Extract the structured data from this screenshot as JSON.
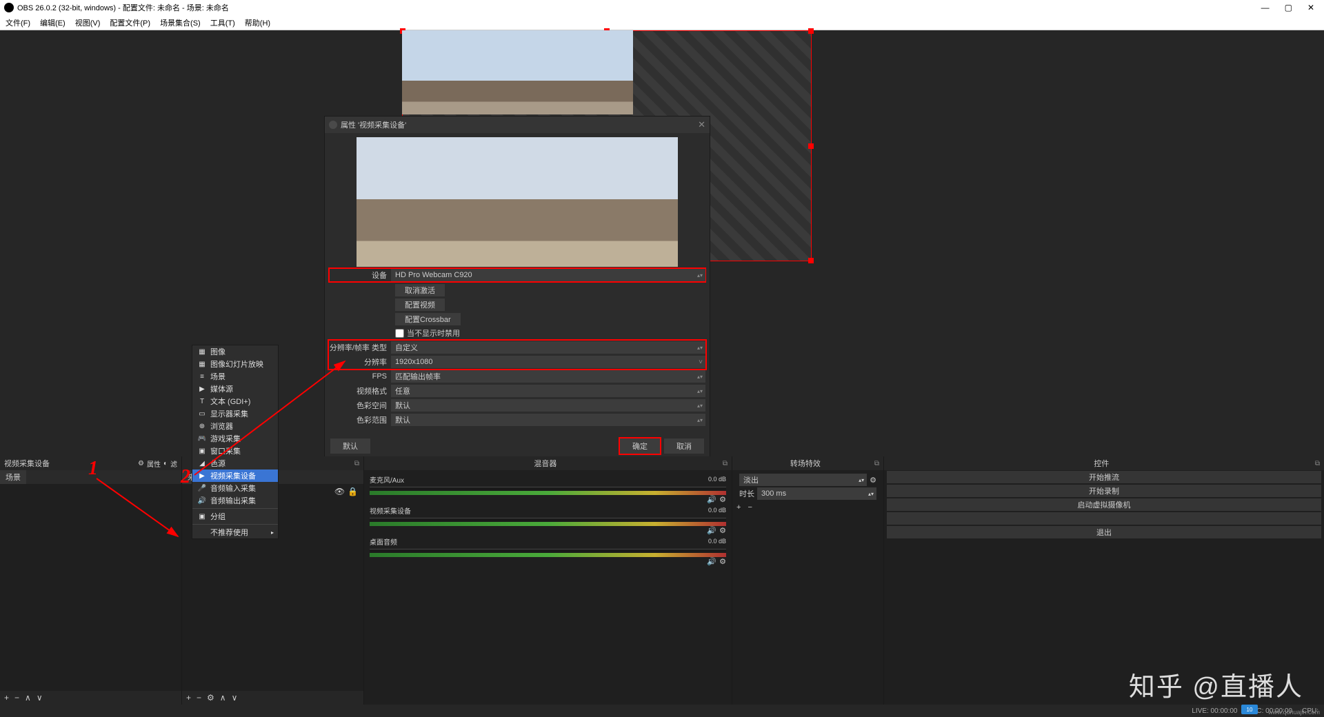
{
  "titlebar": {
    "text": "OBS 26.0.2 (32-bit, windows) - 配置文件: 未命名 - 场景: 未命名"
  },
  "menubar": {
    "items": [
      "文件(F)",
      "编辑(E)",
      "视图(V)",
      "配置文件(P)",
      "场景集合(S)",
      "工具(T)",
      "帮助(H)"
    ]
  },
  "dialog": {
    "title": "属性 '视频采集设备'",
    "device_lbl": "设备",
    "device_val": "HD Pro Webcam C920",
    "deactivate": "取消激活",
    "cfg_video": "配置视频",
    "cfg_crossbar": "配置Crossbar",
    "hide_lbl": "当不显示时禁用",
    "restype_lbl": "分辨率/帧率 类型",
    "restype_val": "自定义",
    "res_lbl": "分辨率",
    "res_val": "1920x1080",
    "fps_lbl": "FPS",
    "fps_val": "匹配输出帧率",
    "vfmt_lbl": "视频格式",
    "vfmt_val": "任意",
    "cspace_lbl": "色彩空间",
    "cspace_val": "默认",
    "crange_lbl": "色彩范围",
    "crange_val": "默认",
    "defaults": "默认",
    "ok": "确定",
    "cancel": "取消"
  },
  "ctx": {
    "items": [
      {
        "ico": "▦",
        "t": "图像"
      },
      {
        "ico": "▦",
        "t": "图像幻灯片放映"
      },
      {
        "ico": "≡",
        "t": "场景"
      },
      {
        "ico": "▶",
        "t": "媒体源"
      },
      {
        "ico": "T",
        "t": "文本 (GDI+)"
      },
      {
        "ico": "▭",
        "t": "显示器采集"
      },
      {
        "ico": "⊕",
        "t": "浏览器"
      },
      {
        "ico": "🎮",
        "t": "游戏采集"
      },
      {
        "ico": "▣",
        "t": "窗口采集"
      },
      {
        "ico": "◢",
        "t": "色源"
      },
      {
        "ico": "▶",
        "t": "视频采集设备",
        "sel": true
      },
      {
        "ico": "🎤",
        "t": "音频输入采集"
      },
      {
        "ico": "🔊",
        "t": "音频输出采集"
      }
    ],
    "group": "分组",
    "deprecated": "不推荐使用"
  },
  "docks": {
    "src_hdr": "视频采集设备",
    "props": "属性",
    "filters": "滤",
    "scenes_tab": "场景",
    "sources_tab": "来源",
    "mixer_hdr": "混音器",
    "trans_hdr": "转场特效",
    "ctrl_hdr": "控件",
    "mix": [
      {
        "n": "麦克风/Aux",
        "db": "0.0 dB"
      },
      {
        "n": "视频采集设备",
        "db": "0.0 dB"
      },
      {
        "n": "桌面音频",
        "db": "0.0 dB"
      }
    ],
    "trans_mode": "淡出",
    "dur_lbl": "时长",
    "dur_val": "300 ms",
    "ctrls": [
      "开始推流",
      "开始录制",
      "启动虚拟摄像机",
      "",
      "退出"
    ]
  },
  "status": {
    "live": "LIVE: 00:00:00",
    "rec": "REC: 00:00:00",
    "cpu": "CPU:"
  },
  "annot": {
    "n1": "1",
    "n2": "2"
  },
  "watermark": "知乎 @直播人",
  "wm2": "www.qdhuajin.com",
  "wmlogo": "10"
}
